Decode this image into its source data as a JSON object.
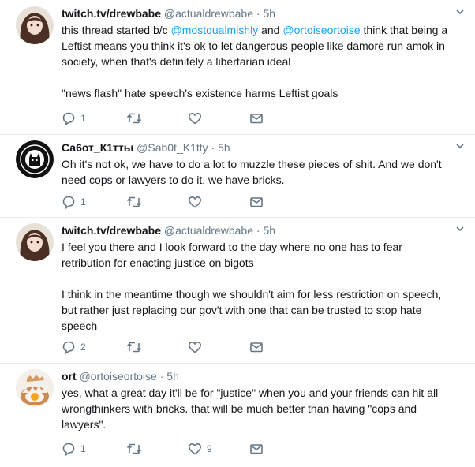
{
  "colors": {
    "text": "#14171a",
    "secondary": "#657786",
    "mention": "#1da1f2",
    "divider": "#e6ecf0"
  },
  "tweets": [
    {
      "name": "twitch.tv/drewbabe",
      "handle": "@actualdrewbabe",
      "dot": "·",
      "time": "5h",
      "avatar": "avatar-drawn-portrait",
      "lines": [
        [
          "this thread started b/c ",
          "@mostqualmishly",
          " and ",
          "@ortoiseortoise",
          " think that being a"
        ],
        [
          "Leftist means you think it's ok to let dangerous people like damore run amok in"
        ],
        [
          "society, when that's definitely a libertarian ideal"
        ]
      ],
      "paragraph2": "\"news flash\" hate speech's existence harms Leftist goals",
      "reply_count": "1",
      "retweet_count": "",
      "like_count": ""
    },
    {
      "name": "Са6от_К1ттьı",
      "handle": "@Sab0t_K1tty",
      "dot": "·",
      "time": "5h",
      "avatar": "avatar-black-cat-emblem",
      "text_line1": "Oh it's not ok, we have to do a lot to muzzle these pieces of shit. And we don't",
      "text_line2": "need cops or lawyers to do it, we have bricks.",
      "reply_count": "1",
      "retweet_count": "",
      "like_count": ""
    },
    {
      "name": "twitch.tv/drewbabe",
      "handle": "@actualdrewbabe",
      "dot": "·",
      "time": "5h",
      "avatar": "avatar-drawn-portrait",
      "p1_line1": "I feel you there and I look forward to the day where no one has to fear",
      "p1_line2": "retribution for enacting justice on bigots",
      "p2_line1": "I think in the meantime though we shouldn't aim for less restriction on speech,",
      "p2_line2": "but rather just replacing our gov't with one that can be trusted to stop hate",
      "p2_line3": "speech",
      "reply_count": "2",
      "retweet_count": "",
      "like_count": ""
    },
    {
      "name": "ort",
      "handle": "@ortoiseortoise",
      "dot": "·",
      "time": "5h",
      "avatar": "avatar-cracked-egg",
      "line1": "yes, what a great day it'll be for \"justice\" when you and your friends can hit all",
      "line2": "wrongthinkers with bricks. that will be much better than having \"cops and",
      "line3": "lawyers\".",
      "reply_count": "1",
      "retweet_count": "",
      "like_count": "9"
    }
  ],
  "icons": {
    "reply": "reply-icon",
    "retweet": "retweet-icon",
    "like": "heart-icon",
    "dm": "envelope-icon",
    "more": "chevron-down-icon"
  }
}
